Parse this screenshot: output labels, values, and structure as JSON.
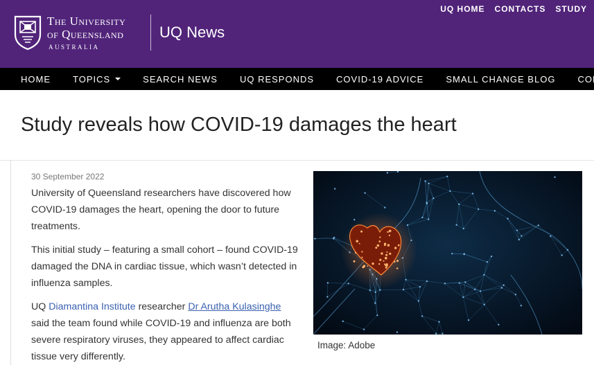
{
  "header": {
    "university_line1": "The University",
    "university_line2": "of Queensland",
    "university_line3": "AUSTRALIA",
    "site_title": "UQ News",
    "top_links": [
      "UQ HOME",
      "CONTACTS",
      "STUDY"
    ],
    "background_color": "#51247a"
  },
  "nav": {
    "items": [
      "HOME",
      "TOPICS",
      "SEARCH NEWS",
      "UQ RESPONDS",
      "COVID-19 ADVICE",
      "SMALL CHANGE BLOG",
      "CONTACTS"
    ]
  },
  "article": {
    "title": "Study reveals how COVID-19 damages the heart",
    "date": "30 September 2022",
    "para1": "University of Queensland researchers have discovered how COVID-19 damages the heart, opening the door to future treatments.",
    "para2": "This initial study – featuring a small cohort – found COVID-19 damaged the DNA in cardiac tissue, which wasn’t detected in influenza samples.",
    "para3_prefix": "UQ ",
    "para3_link1": "Diamantina Institute",
    "para3_mid": " researcher ",
    "para3_link2": "Dr Arutha Kulasinghe",
    "para3_suffix": " said the team found while COVID-19 and influenza are both severe respiratory viruses, they appeared to affect cardiac tissue very differently.",
    "image_caption": "Image: Adobe"
  }
}
